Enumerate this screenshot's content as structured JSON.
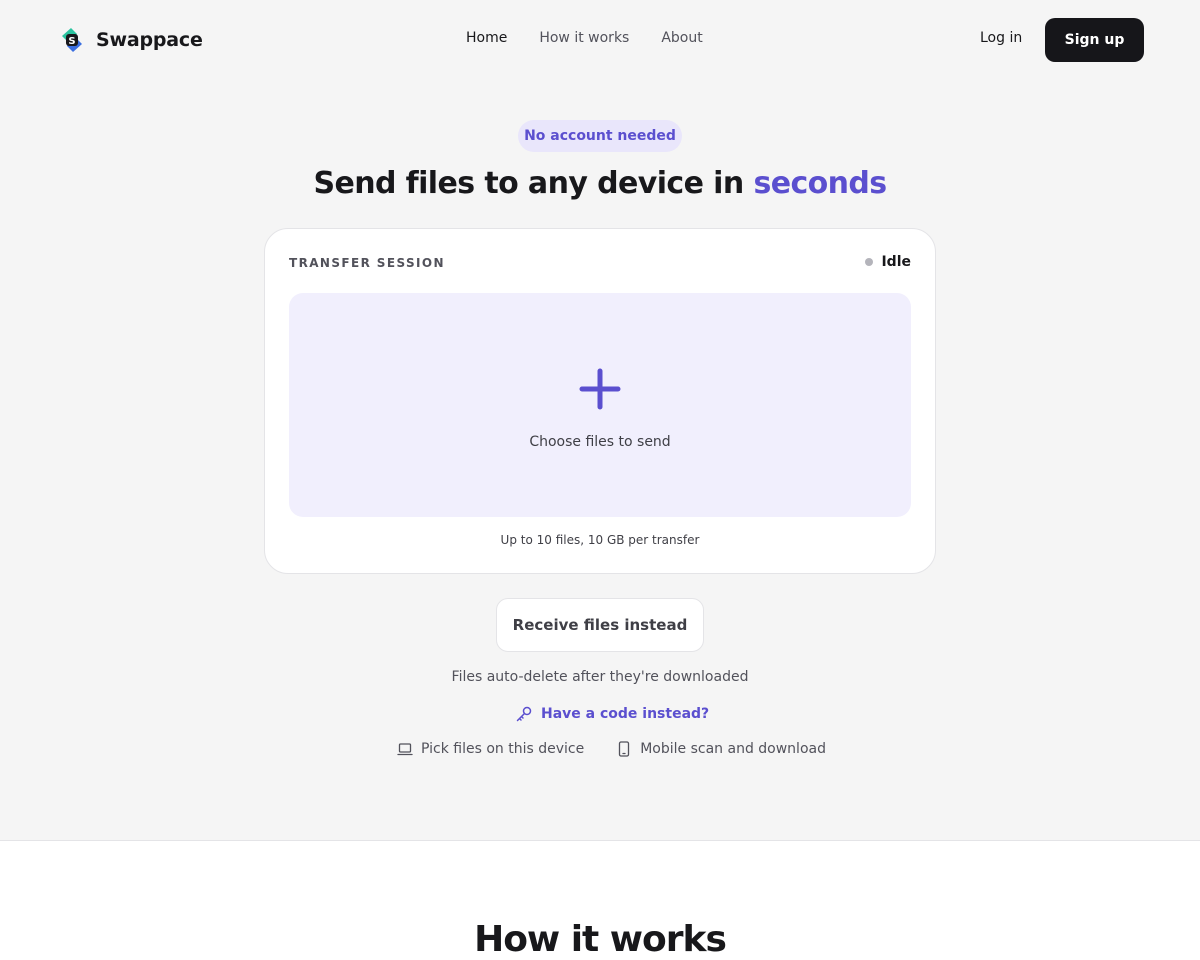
{
  "brand": {
    "name": "Swappace"
  },
  "nav": {
    "items": [
      {
        "label": "Home",
        "active": true
      },
      {
        "label": "How it works",
        "active": false
      },
      {
        "label": "About",
        "active": false
      }
    ],
    "login_label": "Log in",
    "signup_label": "Sign up"
  },
  "hero": {
    "badge": "No account needed",
    "headline_prefix": "Send files to any device in",
    "headline_accent": "seconds"
  },
  "transfer": {
    "title": "TRANSFER SESSION",
    "status": "Idle",
    "dropzone_label": "Choose files to send",
    "limits": "Up to 10 files, 10 GB per transfer"
  },
  "actions": {
    "receive_label": "Receive files instead",
    "autodelete_note": "Files auto-delete after they're downloaded",
    "code_link": "Have a code instead?",
    "options": [
      {
        "icon": "laptop-icon",
        "label": "Pick files on this device"
      },
      {
        "icon": "phone-icon",
        "label": "Mobile scan and download"
      }
    ]
  },
  "section": {
    "title": "How it works"
  },
  "colors": {
    "accent": "#5b4fcf",
    "dark_button": "#16161a",
    "badge_bg": "#e9e6fb",
    "dropzone_bg": "#f1effd",
    "idle_dot": "#b4b4bb"
  }
}
